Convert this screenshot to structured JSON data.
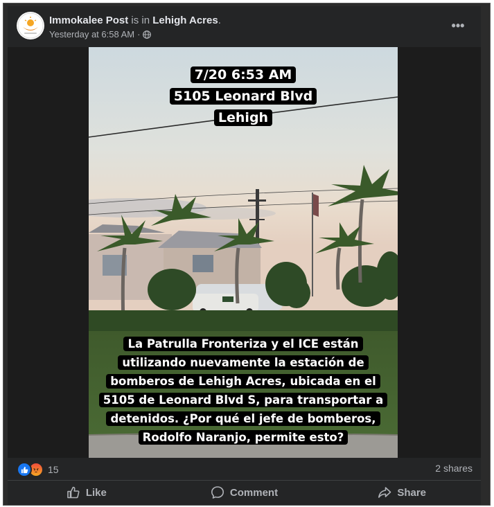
{
  "post": {
    "author": "Immokalee Post",
    "connector": " is in ",
    "location": "Lehigh Acres",
    "period": ".",
    "timestamp": "Yesterday at 6:58 AM",
    "separator": "·",
    "audience_icon": "globe-icon",
    "more_icon": "more-options-icon",
    "more_label": "•••"
  },
  "media": {
    "overlay_top": [
      "7/20 6:53 AM",
      "5105 Leonard Blvd",
      "Lehigh"
    ],
    "overlay_bottom": [
      "La Patrulla Fronteriza y el ICE están",
      "utilizando nuevamente la estación de",
      "bomberos de Lehigh Acres, ubicada en el",
      "5105 de Leonard Blvd S, para transportar a",
      "detenidos. ¿Por qué el jefe de bomberos,",
      "Rodolfo Naranjo, permite esto?"
    ]
  },
  "stats": {
    "reaction_icons": [
      "like-reaction-icon",
      "angry-reaction-icon"
    ],
    "reaction_count": "15",
    "shares": "2 shares"
  },
  "actions": [
    {
      "label": "Like",
      "icon": "thumbs-up-icon"
    },
    {
      "label": "Comment",
      "icon": "comment-icon"
    },
    {
      "label": "Share",
      "icon": "share-icon"
    }
  ],
  "colors": {
    "card_bg": "#242526",
    "text_primary": "#e4e6eb",
    "text_secondary": "#b0b3b8",
    "like_blue": "#1877f2"
  }
}
